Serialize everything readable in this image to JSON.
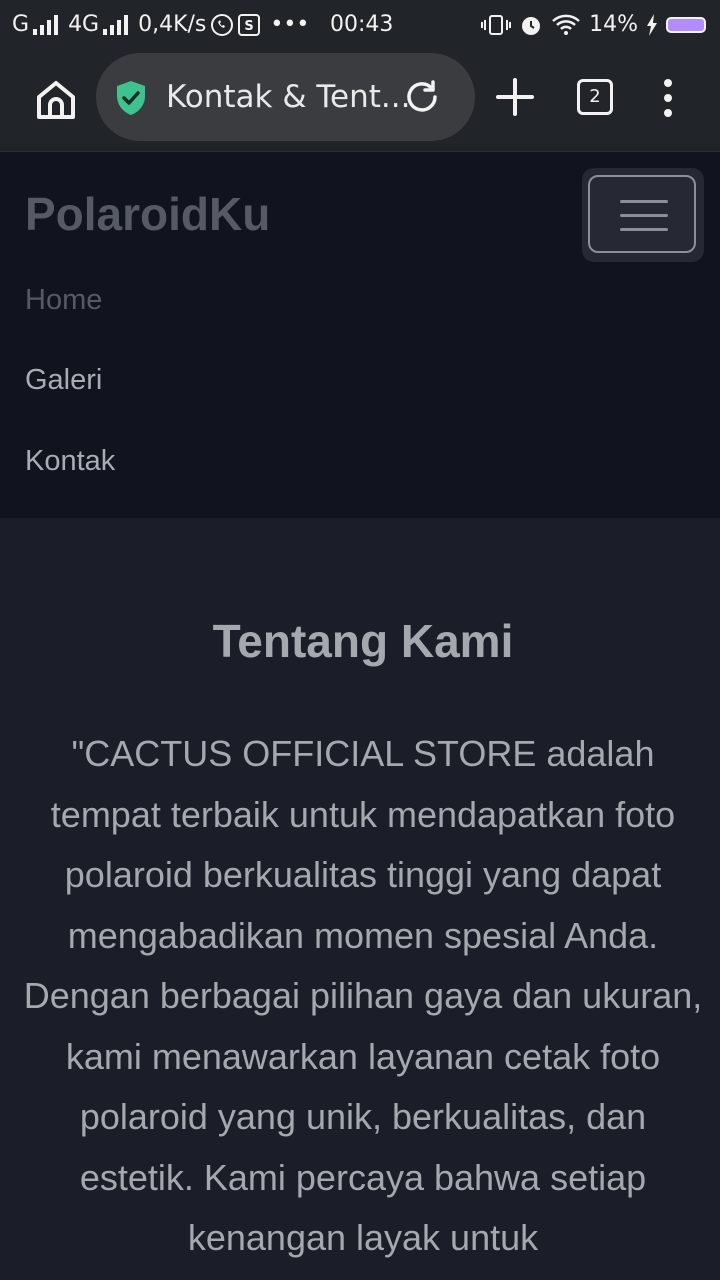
{
  "status_bar": {
    "network_1": "G",
    "network_2": "4G",
    "speed": "0,4K/s",
    "time": "00:43",
    "battery": "14%"
  },
  "browser": {
    "url_title": "Kontak & Tent...",
    "tab_count": "2"
  },
  "navbar": {
    "brand": "PolaroidKu",
    "links": [
      {
        "label": "Home"
      },
      {
        "label": "Galeri"
      },
      {
        "label": "Kontak"
      }
    ]
  },
  "about": {
    "title": "Tentang Kami",
    "text": "\"CACTUS OFFICIAL STORE adalah tempat terbaik untuk mendapatkan foto polaroid berkualitas tinggi yang dapat mengabadikan momen spesial Anda. Dengan berbagai pilihan gaya dan ukuran, kami menawarkan layanan cetak foto polaroid yang unik, berkualitas, dan estetik. Kami percaya bahwa setiap kenangan layak untuk"
  },
  "colors": {
    "accent_green": "#3ec28f",
    "battery_purple": "#b28cff"
  }
}
